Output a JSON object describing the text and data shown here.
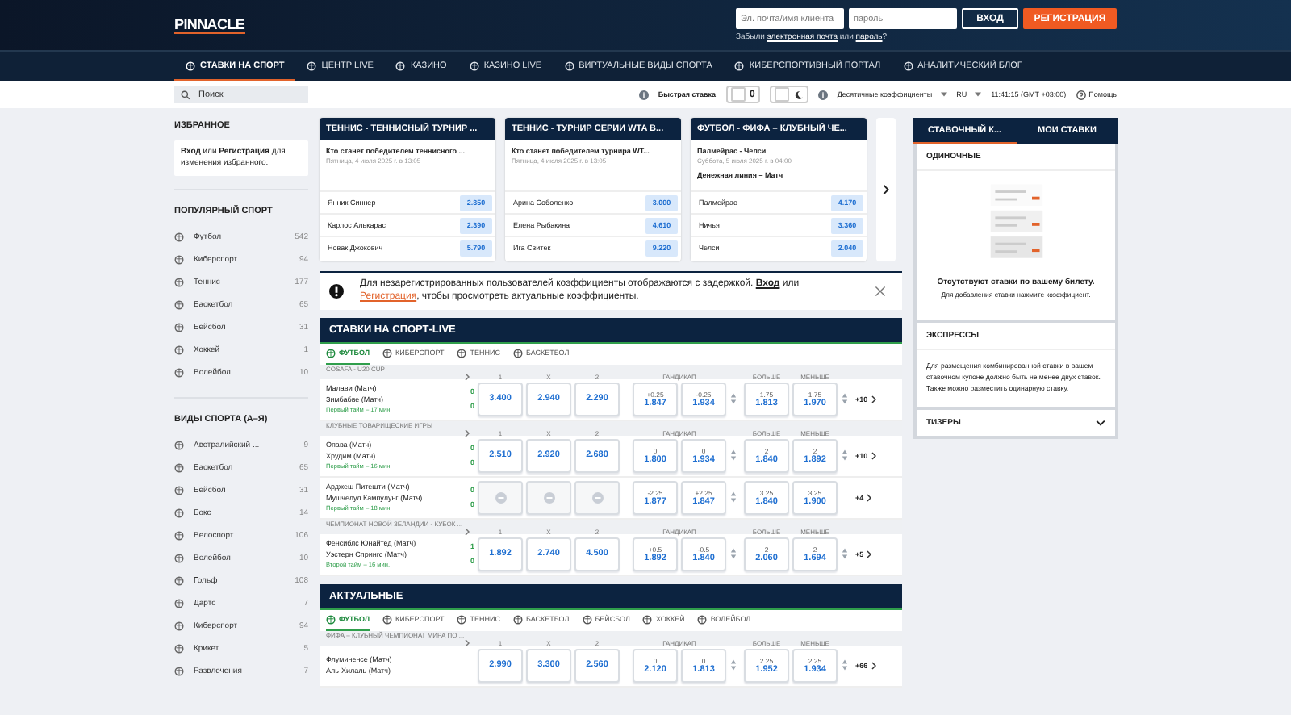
{
  "header": {
    "logo": "PINNACLE",
    "login_placeholder": "Эл. почта/имя клиента",
    "password_placeholder": "пароль",
    "login_button": "ВХОД",
    "register_button": "РЕГИСТРАЦИЯ",
    "forgot": {
      "before": "Забыли",
      "email_link": "электронная почта",
      "middle": "или",
      "password_link": "пароль",
      "after": "?"
    }
  },
  "nav": [
    {
      "label": "СТАВКИ НА СПОРТ",
      "selected": true
    },
    {
      "label": "ЦЕНТР LIVE",
      "selected": false
    },
    {
      "label": "КАЗИНО",
      "selected": false
    },
    {
      "label": "КАЗИНО LIVE",
      "selected": false
    },
    {
      "label": "ВИРТУАЛЬНЫЕ ВИДЫ СПОРТА",
      "selected": false
    },
    {
      "label": "КИБЕРСПОРТИВНЫЙ ПОРТАЛ",
      "selected": false
    },
    {
      "label": "АНАЛИТИЧЕСКИЙ БЛОГ",
      "selected": false
    }
  ],
  "toolbar": {
    "search_placeholder": "Поиск",
    "quick_bet_label": "Быстрая ставка",
    "quick_bet_count": "0",
    "odds_format": "Десятичные коэффициенты",
    "language": "RU",
    "dark_mode": false,
    "time": "11:41:15 (GMT +03:00)",
    "help": "Помощь"
  },
  "sidebar": {
    "favorites_title": "ИЗБРАННОЕ",
    "favorites_note": "**Вход** или **Регистрация** для изменения избранного.",
    "popular_title": "ПОПУЛЯРНЫЙ СПОРТ",
    "popular": [
      {
        "label": "Футбол",
        "count": "542"
      },
      {
        "label": "Киберспорт",
        "count": "94"
      },
      {
        "label": "Теннис",
        "count": "177"
      },
      {
        "label": "Баскетбол",
        "count": "65"
      },
      {
        "label": "Бейсбол",
        "count": "31"
      },
      {
        "label": "Хоккей",
        "count": "1"
      },
      {
        "label": "Волейбол",
        "count": "10"
      }
    ],
    "az_title": "ВИДЫ СПОРТА (А–Я)",
    "az": [
      {
        "label": "Австралийский ...",
        "count": "9"
      },
      {
        "label": "Баскетбол",
        "count": "65"
      },
      {
        "label": "Бейсбол",
        "count": "31"
      },
      {
        "label": "Бокс",
        "count": "14"
      },
      {
        "label": "Велоспорт",
        "count": "106"
      },
      {
        "label": "Волейбол",
        "count": "10"
      },
      {
        "label": "Гольф",
        "count": "108"
      },
      {
        "label": "Дартс",
        "count": "7"
      },
      {
        "label": "Киберспорт",
        "count": "94"
      },
      {
        "label": "Крикет",
        "count": "5"
      },
      {
        "label": "Развлечения",
        "count": "7"
      }
    ]
  },
  "featured": [
    {
      "title": "ТЕННИС - ТЕННИСНЫЙ ТУРНИР ...",
      "event": "Кто станет победителем теннисного ...",
      "date": "Пятница, 4 июля 2025 г. в 13:05",
      "selections": [
        {
          "name": "Янник Синнер",
          "odds": "2.350"
        },
        {
          "name": "Карлос Алькарас",
          "odds": "2.390"
        },
        {
          "name": "Новак Джокович",
          "odds": "5.790"
        }
      ]
    },
    {
      "title": "ТЕННИС - ТУРНИР СЕРИИ WTA В...",
      "event": "Кто станет победителем турнира WT...",
      "date": "Пятница, 4 июля 2025 г. в 13:05",
      "selections": [
        {
          "name": "Арина Соболенко",
          "odds": "3.000"
        },
        {
          "name": "Елена Рыбакина",
          "odds": "4.610"
        },
        {
          "name": "Ига Свитек",
          "odds": "9.220"
        }
      ]
    },
    {
      "title": "ФУТБОЛ - ФИФА – КЛУБНЫЙ ЧЕ...",
      "event": "Палмейрас - Челси",
      "date": "Суббота, 5 июля 2025 г. в 04:00",
      "market": "Денежная линия – Матч",
      "selections": [
        {
          "name": "Палмейрас",
          "odds": "4.170"
        },
        {
          "name": "Ничья",
          "odds": "3.360"
        },
        {
          "name": "Челси",
          "odds": "2.040"
        }
      ]
    }
  ],
  "notice": {
    "before": "Для незарегистрированных пользователей коэффициенты отображаются с задержкой.",
    "login_link": "Вход",
    "middle": "или",
    "register_link": "Регистрация",
    "after": ", чтобы просмотреть актуальные коэффициенты."
  },
  "live": {
    "title": "СТАВКИ НА СПОРТ-LIVE",
    "tabs": [
      {
        "label": "ФУТБОЛ",
        "selected": true
      },
      {
        "label": "КИБЕРСПОРТ",
        "selected": false
      },
      {
        "label": "ТЕННИС",
        "selected": false
      },
      {
        "label": "БАСКЕТБОЛ",
        "selected": false
      }
    ],
    "leagues": [
      {
        "name": "COSAFA - U20 CUP",
        "headers": [
          "1",
          "X",
          "2",
          "ГАНДИКАП",
          "БОЛЬШЕ",
          "МЕНЬШЕ"
        ],
        "matches": [
          {
            "home": "Малави (Матч)",
            "away": "Зимбабве (Матч)",
            "score_home": "0",
            "score_away": "0",
            "period": "Первый тайм – 17 мин.",
            "locked": false,
            "moneyline": [
              "3.400",
              "2.940",
              "2.290"
            ],
            "handicap": [
              {
                "line": "+0.25",
                "odds": "1.847"
              },
              {
                "line": "-0.25",
                "odds": "1.934"
              }
            ],
            "totals": [
              {
                "line": "1.75",
                "odds": "1.813"
              },
              {
                "line": "1.75",
                "odds": "1.970"
              }
            ],
            "totals_adjustable": true,
            "more": "+10"
          }
        ]
      },
      {
        "name": "КЛУБНЫЕ ТОВАРИЩЕСКИЕ ИГРЫ",
        "headers": [
          "1",
          "X",
          "2",
          "ГАНДИКАП",
          "БОЛЬШЕ",
          "МЕНЬШЕ"
        ],
        "matches": [
          {
            "home": "Опава (Матч)",
            "away": "Хрудим (Матч)",
            "score_home": "0",
            "score_away": "0",
            "period": "Первый тайм – 16 мин.",
            "locked": false,
            "moneyline": [
              "2.510",
              "2.920",
              "2.680"
            ],
            "handicap": [
              {
                "line": "0",
                "odds": "1.800"
              },
              {
                "line": "0",
                "odds": "1.934"
              }
            ],
            "totals": [
              {
                "line": "2",
                "odds": "1.840"
              },
              {
                "line": "2",
                "odds": "1.892"
              }
            ],
            "totals_adjustable": true,
            "more": "+10"
          },
          {
            "home": "Арджеш Питешти (Матч)",
            "away": "Мушчелул Кампулунг (Матч)",
            "score_home": "0",
            "score_away": "0",
            "period": "Первый тайм – 18 мин.",
            "locked": true,
            "handicap": [
              {
                "line": "-2.25",
                "odds": "1.877"
              },
              {
                "line": "+2.25",
                "odds": "1.847"
              }
            ],
            "totals": [
              {
                "line": "3.25",
                "odds": "1.840"
              },
              {
                "line": "3.25",
                "odds": "1.900"
              }
            ],
            "totals_adjustable": false,
            "more": "+4"
          }
        ]
      },
      {
        "name": "ЧЕМПИОНАТ НОВОЙ ЗЕЛАНДИИ - КУБОК ...",
        "headers": [
          "1",
          "X",
          "2",
          "ГАНДИКАП",
          "БОЛЬШЕ",
          "МЕНЬШЕ"
        ],
        "matches": [
          {
            "home": "Фенсиблс Юнайтед (Матч)",
            "away": "Уэстерн Спрингс (Матч)",
            "score_home": "1",
            "score_away": "0",
            "period": "Второй тайм – 16 мин.",
            "locked": false,
            "moneyline": [
              "1.892",
              "2.740",
              "4.500"
            ],
            "handicap": [
              {
                "line": "+0.5",
                "odds": "1.892"
              },
              {
                "line": "-0.5",
                "odds": "1.840"
              }
            ],
            "totals": [
              {
                "line": "2",
                "odds": "2.060"
              },
              {
                "line": "2",
                "odds": "1.694"
              }
            ],
            "totals_adjustable": true,
            "more": "+5"
          }
        ]
      }
    ]
  },
  "featured_now": {
    "title": "АКТУАЛЬНЫЕ",
    "tabs": [
      {
        "label": "ФУТБОЛ",
        "selected": true
      },
      {
        "label": "КИБЕРСПОРТ",
        "selected": false
      },
      {
        "label": "ТЕННИС",
        "selected": false
      },
      {
        "label": "БАСКЕТБОЛ",
        "selected": false
      },
      {
        "label": "БЕЙСБОЛ",
        "selected": false
      },
      {
        "label": "ХОККЕЙ",
        "selected": false
      },
      {
        "label": "ВОЛЕЙБОЛ",
        "selected": false
      }
    ],
    "leagues": [
      {
        "name": "ФИФА – КЛУБНЫЙ ЧЕМПИОНАТ МИРА ПО ...",
        "headers": [
          "1",
          "X",
          "2",
          "ГАНДИКАП",
          "БОЛЬШЕ",
          "МЕНЬШЕ"
        ],
        "matches": [
          {
            "home": "Флуминенсе (Матч)",
            "away": "Аль-Хилаль (Матч)",
            "locked": false,
            "moneyline": [
              "2.990",
              "3.300",
              "2.560"
            ],
            "handicap": [
              {
                "line": "0",
                "odds": "2.120"
              },
              {
                "line": "0",
                "odds": "1.813"
              }
            ],
            "totals": [
              {
                "line": "2.25",
                "odds": "1.952"
              },
              {
                "line": "2.25",
                "odds": "1.934"
              }
            ],
            "totals_adjustable": true,
            "more": "+66"
          }
        ]
      }
    ]
  },
  "betslip": {
    "tabs": [
      {
        "label": "СТАВОЧНЫЙ К...",
        "selected": true
      },
      {
        "label": "МОИ СТАВКИ",
        "selected": false
      }
    ],
    "singles_title": "ОДИНОЧНЫЕ",
    "empty_title": "Отсутствуют ставки по вашему билету.",
    "empty_hint": "Для добавления ставки нажмите коэффициент.",
    "express_title": "ЭКСПРЕССЫ",
    "express_text": "Для размещения комбинированной ставки в вашем ставочном купоне должно быть не менее двух ставок. Также можно разместить одинарную ставку.",
    "teasers_title": "ТИЗЕРЫ",
    "teasers_expanded": false
  }
}
